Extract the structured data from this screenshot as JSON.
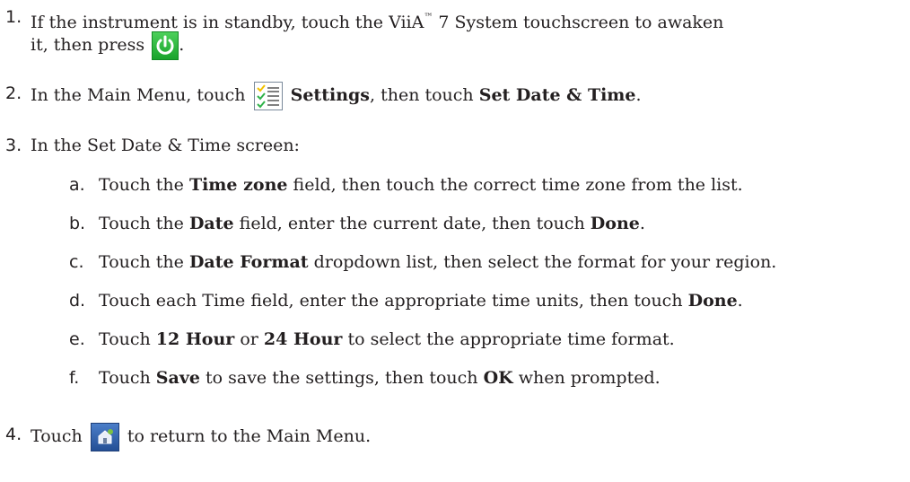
{
  "steps": [
    {
      "num": "1.",
      "line1_pre": "If the instrument is in standby, touch the ViiA",
      "tm": "™",
      "line1_post": " 7 System touchscreen to awaken",
      "line2_pre": "it, then press",
      "line2_post": ".",
      "icon": "power-icon"
    },
    {
      "num": "2.",
      "pre": "In the Main Menu, touch",
      "bold1": "Settings",
      "mid": ", then touch",
      "bold2": "Set Date & Time",
      "post": ".",
      "icon": "settings-checklist-icon"
    },
    {
      "num": "3.",
      "text": "In the Set Date & Time screen:"
    },
    {
      "num": "4.",
      "pre": "Touch",
      "post": "to return to the Main Menu.",
      "icon": "home-icon"
    }
  ],
  "substeps": [
    {
      "num": "a.",
      "pre": "Touch the ",
      "b1": "Time zone",
      "mid": " field, then touch the correct time zone from the list.",
      "b2": "",
      "post": ""
    },
    {
      "num": "b.",
      "pre": "Touch the ",
      "b1": "Date",
      "mid": " field, enter the current date, then touch ",
      "b2": "Done",
      "post": "."
    },
    {
      "num": "c.",
      "pre": "Touch the ",
      "b1": "Date Format",
      "mid": " dropdown list, then select the format for your region.",
      "b2": "",
      "post": ""
    },
    {
      "num": "d.",
      "pre": "Touch each Time field, enter the appropriate time units, then touch ",
      "b1": "Done",
      "mid": ".",
      "b2": "",
      "post": ""
    },
    {
      "num": "e.",
      "pre": "Touch ",
      "b1": "12 Hour",
      "mid": " or ",
      "b2": "24 Hour",
      "post": " to select the appropriate time format."
    },
    {
      "num": "f.",
      "pre": "Touch ",
      "b1": "Save",
      "mid": " to save the settings, then touch ",
      "b2": "OK",
      "post": " when prompted."
    }
  ]
}
